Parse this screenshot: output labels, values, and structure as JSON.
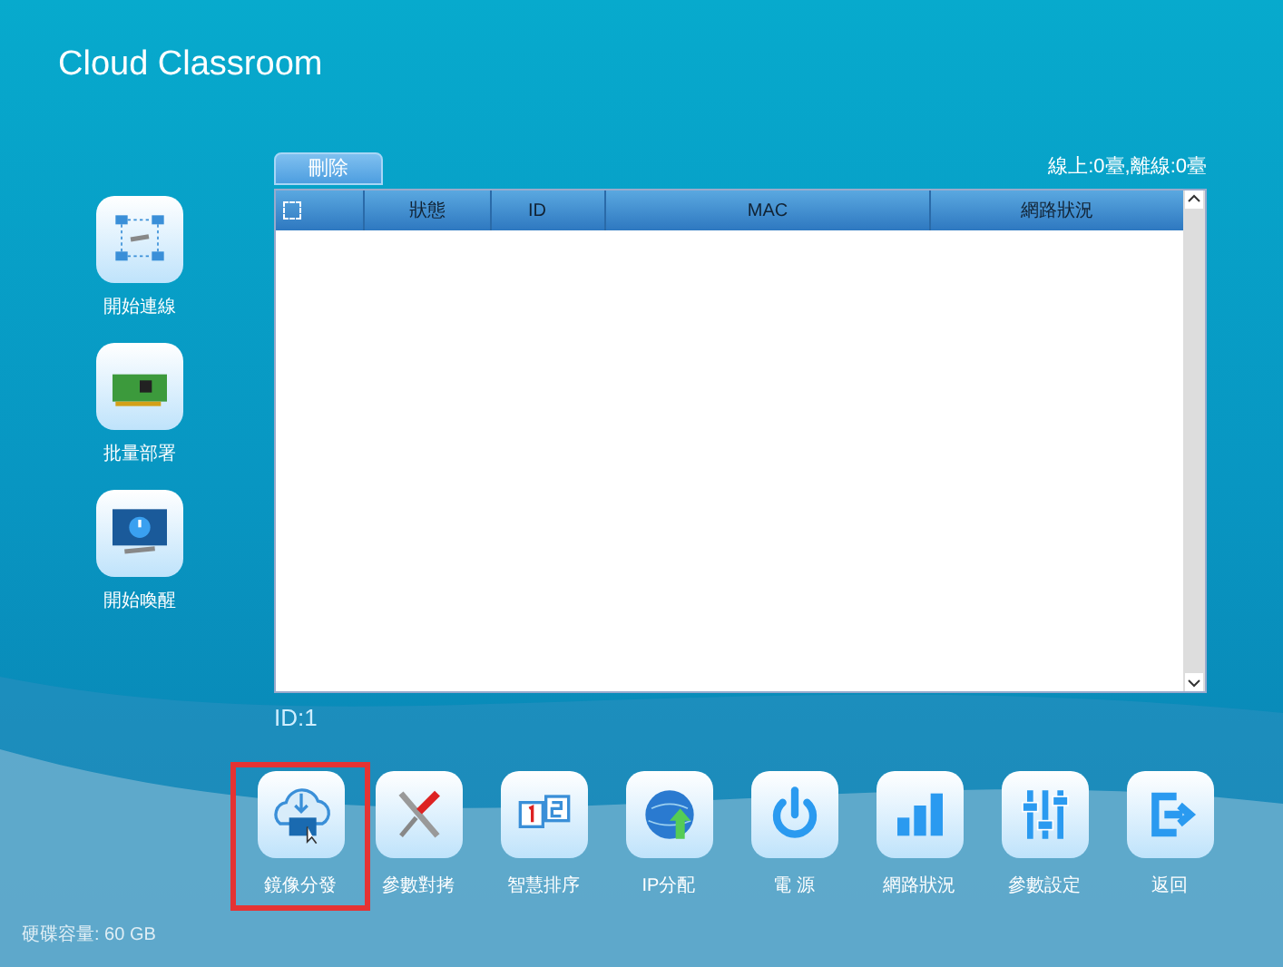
{
  "window": {
    "title": "Cloud Classroom"
  },
  "side_tools": [
    {
      "kind": "network",
      "label": "開始連線"
    },
    {
      "kind": "pxe",
      "label": "批量部署"
    },
    {
      "kind": "wake",
      "label": "開始喚醒"
    }
  ],
  "delete_button": "刪除",
  "online_summary": "線上:0臺,離線:0臺",
  "table": {
    "select_all_checked": false,
    "columns": [
      "狀態",
      "ID",
      "MAC",
      "網路狀況"
    ]
  },
  "id_label": "ID:1",
  "tools": [
    {
      "kind": "cloud",
      "label": "鏡像分發",
      "selected": true
    },
    {
      "kind": "tools",
      "label": "參數對拷",
      "selected": false
    },
    {
      "kind": "sort",
      "label": "智慧排序",
      "selected": false
    },
    {
      "kind": "globe",
      "label": "IP分配",
      "selected": false
    },
    {
      "kind": "power",
      "label": "電 源",
      "selected": false
    },
    {
      "kind": "bars",
      "label": "網路狀況",
      "selected": false
    },
    {
      "kind": "sliders",
      "label": "參數設定",
      "selected": false
    },
    {
      "kind": "exit",
      "label": "返回",
      "selected": false
    }
  ],
  "disk_info": "硬碟容量: 60 GB"
}
